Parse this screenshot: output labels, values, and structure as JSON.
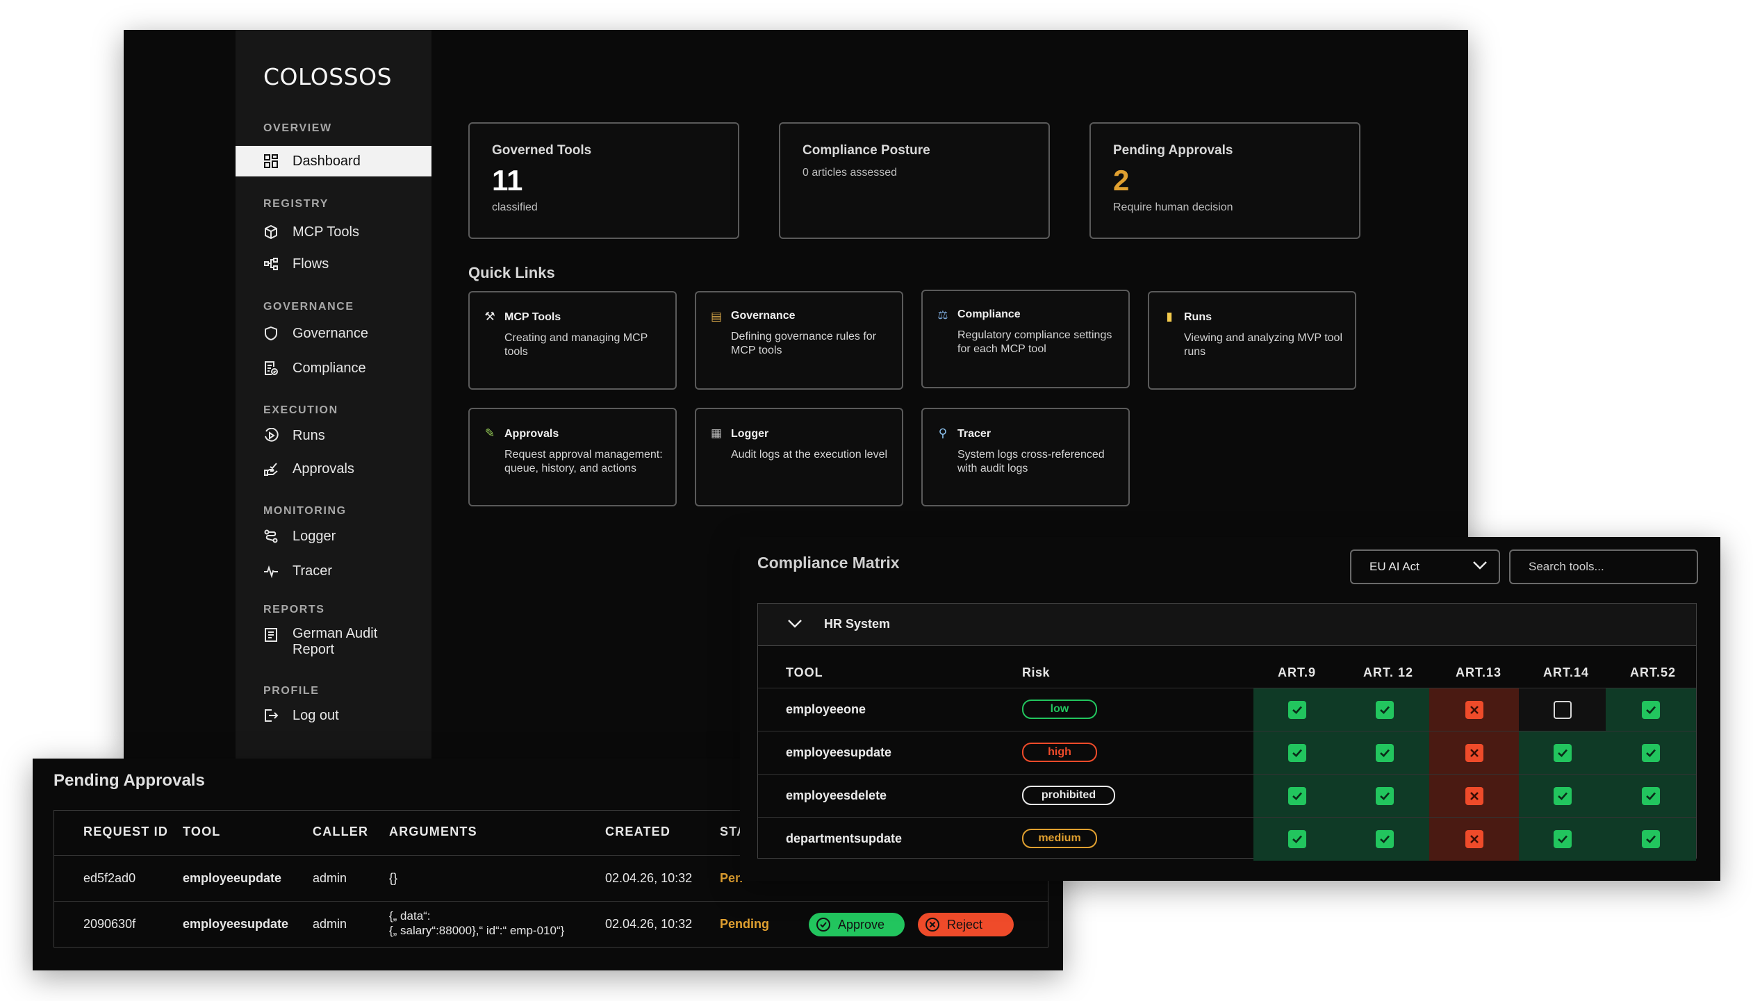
{
  "brand": "COLOSSOS",
  "sidebar": {
    "sections": [
      {
        "title": "OVERVIEW",
        "items": [
          {
            "label": "Dashboard",
            "icon": "dashboard-icon"
          }
        ]
      },
      {
        "title": "REGISTRY",
        "items": [
          {
            "label": "MCP Tools",
            "icon": "cube-icon"
          },
          {
            "label": "Flows",
            "icon": "flows-icon"
          }
        ]
      },
      {
        "title": "GOVERNANCE",
        "items": [
          {
            "label": "Governance",
            "icon": "shield-icon"
          },
          {
            "label": "Compliance",
            "icon": "document-check-icon"
          }
        ]
      },
      {
        "title": "EXECUTION",
        "items": [
          {
            "label": "Runs",
            "icon": "play-circle-icon"
          },
          {
            "label": "Approvals",
            "icon": "approve-hand-icon"
          }
        ]
      },
      {
        "title": "MONITORING",
        "items": [
          {
            "label": "Logger",
            "icon": "route-icon"
          },
          {
            "label": "Tracer",
            "icon": "pulse-icon"
          }
        ]
      },
      {
        "title": "REPORTS",
        "items": [
          {
            "label": "German Audit",
            "label2": "Report",
            "icon": "report-icon"
          }
        ]
      },
      {
        "title": "PROFILE",
        "items": [
          {
            "label": "Log out",
            "icon": "logout-icon"
          }
        ]
      }
    ]
  },
  "stats": [
    {
      "title": "Governed Tools",
      "value": "11",
      "sub": "classified",
      "color": "#ffffff"
    },
    {
      "title": "Compliance Posture",
      "value": "",
      "sub": "0 articles assessed",
      "color": "#ffffff"
    },
    {
      "title": "Pending Approvals",
      "value": "2",
      "sub": "Require human decision",
      "color": "#e0a030"
    }
  ],
  "quick_links": {
    "title": "Quick Links",
    "items": [
      {
        "title": "MCP Tools",
        "desc": "Creating and managing MCP tools",
        "icon": "tools-icon"
      },
      {
        "title": "Governance",
        "desc": "Defining governance rules for MCP tools",
        "icon": "clipboard-icon"
      },
      {
        "title": "Compliance",
        "desc": "Regulatory compliance settings for each MCP tool",
        "icon": "judge-icon"
      },
      {
        "title": "Runs",
        "desc": "Viewing and analyzing MVP tool runs",
        "icon": "notepad-icon"
      },
      {
        "title": "Approvals",
        "desc": "Request approval management: queue, history, and actions",
        "icon": "pen-icon"
      },
      {
        "title": "Logger",
        "desc": "Audit logs at the execution level",
        "icon": "log-icon"
      },
      {
        "title": "Tracer",
        "desc": "System logs cross-referenced with audit logs",
        "icon": "magnifier-icon"
      }
    ]
  },
  "approvals": {
    "title": "Pending Approvals",
    "columns": [
      "REQUEST ID",
      "TOOL",
      "CALLER",
      "ARGUMENTS",
      "CREATED",
      "STA"
    ],
    "rows": [
      {
        "id": "ed5f2ad0",
        "tool": "employeeupdate",
        "caller": "admin",
        "args": "{}",
        "args2": "",
        "created": "02.04.26, 10:32",
        "status": "Pen"
      },
      {
        "id": "2090630f",
        "tool": "employeesupdate",
        "caller": "admin",
        "args": "{„ data“:",
        "args2": "{„ salary“:88000},“ id“:“ emp-010“}",
        "created": "02.04.26, 10:32",
        "status": "Pending"
      }
    ],
    "approve_label": "Approve",
    "reject_label": "Reject",
    "approve_color": "#22c55e",
    "reject_color": "#ef4b2a",
    "pending_color": "#e0a030"
  },
  "compliance": {
    "title": "Compliance Matrix",
    "framework": "EU AI Act",
    "search_placeholder": "Search tools...",
    "group": "HR System",
    "columns": {
      "tool": "TOOL",
      "risk": "Risk",
      "articles": [
        "ART.9",
        "ART. 12",
        "ART.13",
        "ART.14",
        "ART.52"
      ]
    },
    "rows": [
      {
        "tool": "employeeone",
        "risk": "low",
        "risk_color": "#22c55e",
        "cells": [
          "pass",
          "pass",
          "fail",
          "empty",
          "pass"
        ]
      },
      {
        "tool": "employeesupdate",
        "risk": "high",
        "risk_color": "#ef4b2a",
        "cells": [
          "pass",
          "pass",
          "fail",
          "pass",
          "pass"
        ]
      },
      {
        "tool": "employeesdelete",
        "risk": "prohibited",
        "risk_color": "#e8e8e8",
        "cells": [
          "pass",
          "pass",
          "fail",
          "pass",
          "pass"
        ]
      },
      {
        "tool": "departmentsupdate",
        "risk": "medium",
        "risk_color": "#e0a030",
        "cells": [
          "pass",
          "pass",
          "fail",
          "pass",
          "pass"
        ]
      }
    ]
  }
}
